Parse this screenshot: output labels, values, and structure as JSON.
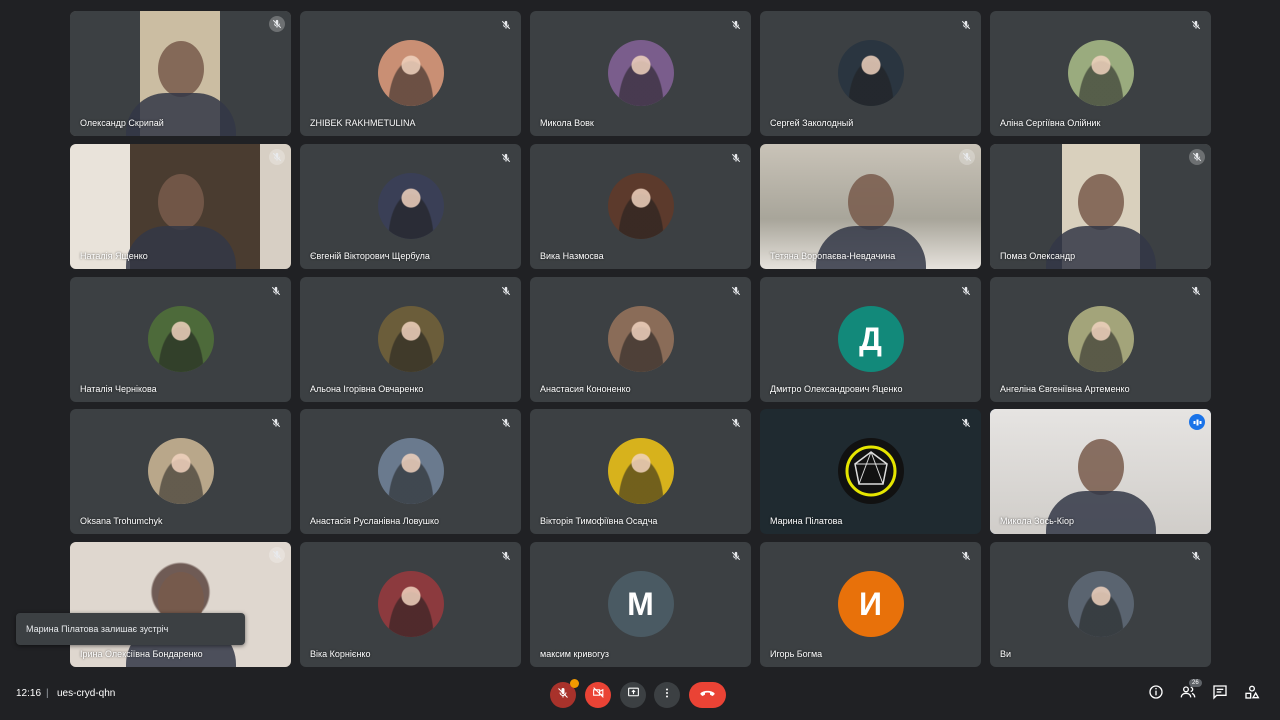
{
  "participants": [
    {
      "name": "Олександр Скрипай",
      "type": "video",
      "mic": "off"
    },
    {
      "name": "ZHIBEK RAKHMETULINA",
      "type": "photo",
      "mic": "off",
      "color": "#c98f74"
    },
    {
      "name": "Микола Вовк",
      "type": "photo",
      "mic": "off",
      "color": "#7a5d8c"
    },
    {
      "name": "Сергей Заколодный",
      "type": "photo",
      "mic": "off",
      "color": "#2a3540"
    },
    {
      "name": "Аліна Сергіївна Олійник",
      "type": "photo",
      "mic": "off",
      "color": "#9aab7e"
    },
    {
      "name": "Наталія Ященко",
      "type": "video",
      "mic": "off"
    },
    {
      "name": "Євгеній Вікторович Щербула",
      "type": "photo",
      "mic": "off",
      "color": "#3a3f56"
    },
    {
      "name": "Вика Назмосва",
      "type": "photo",
      "mic": "off",
      "color": "#5c3a2c"
    },
    {
      "name": "Тетяна Воропаєва-Невдачина",
      "type": "video",
      "mic": "off"
    },
    {
      "name": "Помаз Олександр",
      "type": "video",
      "mic": "off"
    },
    {
      "name": "Наталія Чернікова",
      "type": "photo",
      "mic": "off",
      "color": "#4d6a3a"
    },
    {
      "name": "Альона Ігорівна Овчаренко",
      "type": "photo",
      "mic": "off",
      "color": "#6b5d3a"
    },
    {
      "name": "Анастасия Кононенко",
      "type": "photo",
      "mic": "off",
      "color": "#8a6c58"
    },
    {
      "name": "Дмитро Олександрович Яценко",
      "type": "letter",
      "letter": "Д",
      "mic": "off",
      "color": "#12897a"
    },
    {
      "name": "Ангеліна Євгеніївна Артеменко",
      "type": "photo",
      "mic": "off",
      "color": "#a3a47a"
    },
    {
      "name": "Oksana Trohumchyk",
      "type": "photo",
      "mic": "off",
      "color": "#b9a78a"
    },
    {
      "name": "Анастасія Русланівна Ловушко",
      "type": "photo",
      "mic": "off",
      "color": "#6a7a8e"
    },
    {
      "name": "Вікторія Тимофіївна Осадча",
      "type": "photo",
      "mic": "off",
      "color": "#d7b21c"
    },
    {
      "name": "Марина Пілатова",
      "type": "logo",
      "mic": "off"
    },
    {
      "name": "Микола Зось-Кіор",
      "type": "video",
      "mic": "speaking"
    },
    {
      "name": "Ірина Олексіївна Бондаренко",
      "type": "video",
      "mic": "off"
    },
    {
      "name": "Віка Корнієнко",
      "type": "photo",
      "mic": "off",
      "color": "#8c3a3e"
    },
    {
      "name": "максим кривогуз",
      "type": "letter",
      "letter": "М",
      "mic": "off",
      "color": "#4a5a63"
    },
    {
      "name": "Игорь Богма",
      "type": "letter",
      "letter": "И",
      "mic": "off",
      "color": "#e8710a"
    },
    {
      "name": "Ви",
      "type": "photo",
      "mic": "off",
      "color": "#5a6470"
    }
  ],
  "toast": {
    "text": "Марина Пілатова залишає зустріч"
  },
  "bottom": {
    "time": "12:16",
    "separator": "|",
    "meeting_code": "ues-cryd-qhn",
    "participants_count": "26",
    "colors": {
      "red": "#ea4335",
      "dark": "#3c4043",
      "badge": "#f29900"
    },
    "icons": [
      "mic-off-icon",
      "camera-off-icon",
      "present-icon",
      "more-icon",
      "hang-up-icon",
      "info-icon",
      "people-icon",
      "chat-icon",
      "activities-icon"
    ]
  }
}
